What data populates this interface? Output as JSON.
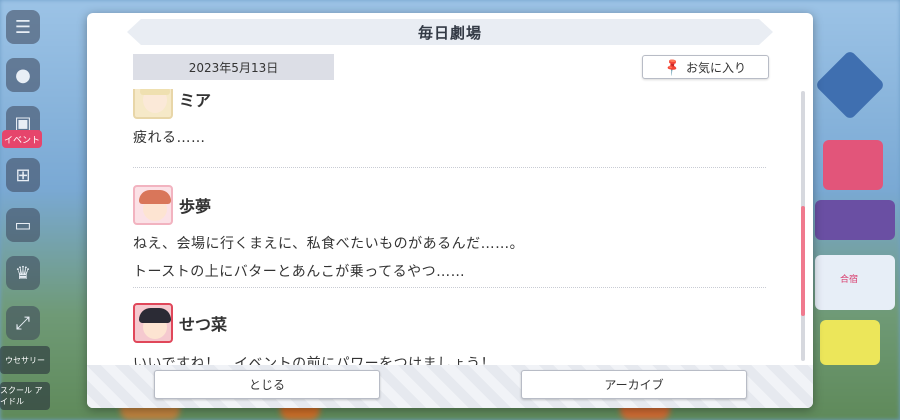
{
  "dialog": {
    "title": "毎日劇場",
    "date": "2023年5月13日",
    "favorite_label": "お気に入り",
    "close_label": "とじる",
    "archive_label": "アーカイブ"
  },
  "entries": [
    {
      "speaker": "ミア",
      "lines": [
        "疲れる……"
      ],
      "avatar": "mia-avatar"
    },
    {
      "speaker": "歩夢",
      "lines": [
        "ねえ、会場に行くまえに、私食べたいものがあるんだ……。",
        "トーストの上にバターとあんこが乗ってるやつ……"
      ],
      "avatar": "ayumu-avatar"
    },
    {
      "speaker": "せつ菜",
      "lines": [
        "いいですね！　イベントの前にパワーをつけましょう！"
      ],
      "avatar": "setsuna-avatar"
    }
  ],
  "background": {
    "left_labels": [
      "イベント",
      "ウセサリー",
      "スクール\nアイドル"
    ],
    "right_labels": [
      "合宿"
    ]
  },
  "colors": {
    "accent": "#f07a8e",
    "title_bar": "#e9edf3",
    "date_box": "#dcdee6"
  }
}
